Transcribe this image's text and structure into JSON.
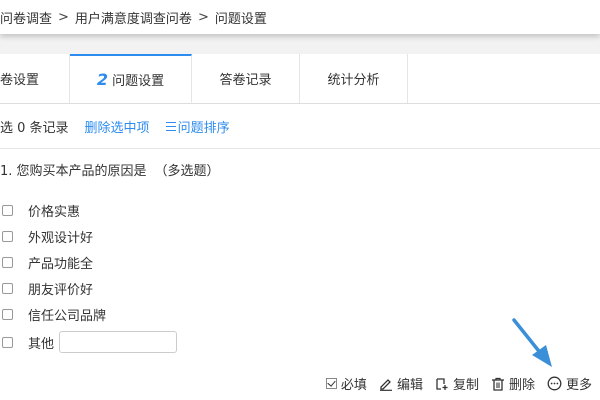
{
  "breadcrumb": {
    "items": [
      "问卷调查",
      "用户满意度调查问卷",
      "问题设置"
    ],
    "separator": ">"
  },
  "tabs": [
    {
      "label": "卷设置",
      "active": false
    },
    {
      "number": "2",
      "label": "问题设置",
      "active": true
    },
    {
      "label": "答卷记录",
      "active": false
    },
    {
      "label": "统计分析",
      "active": false
    }
  ],
  "toolbar": {
    "selected_count": "选 0 条记录",
    "delete_selected": "删除选中项",
    "sort_questions": "问题排序"
  },
  "question": {
    "title": "1. 您购买本产品的原因是",
    "type": "（多选题）",
    "options": [
      "价格实惠",
      "外观设计好",
      "产品功能全",
      "朋友评价好",
      "信任公司品牌"
    ],
    "other_label": "其他",
    "other_value": ""
  },
  "actions": {
    "required": "必填",
    "edit": "编辑",
    "copy": "复制",
    "delete": "删除",
    "more": "更多"
  },
  "colors": {
    "accent": "#2d8cf0",
    "arrow": "#3a8fd8"
  }
}
